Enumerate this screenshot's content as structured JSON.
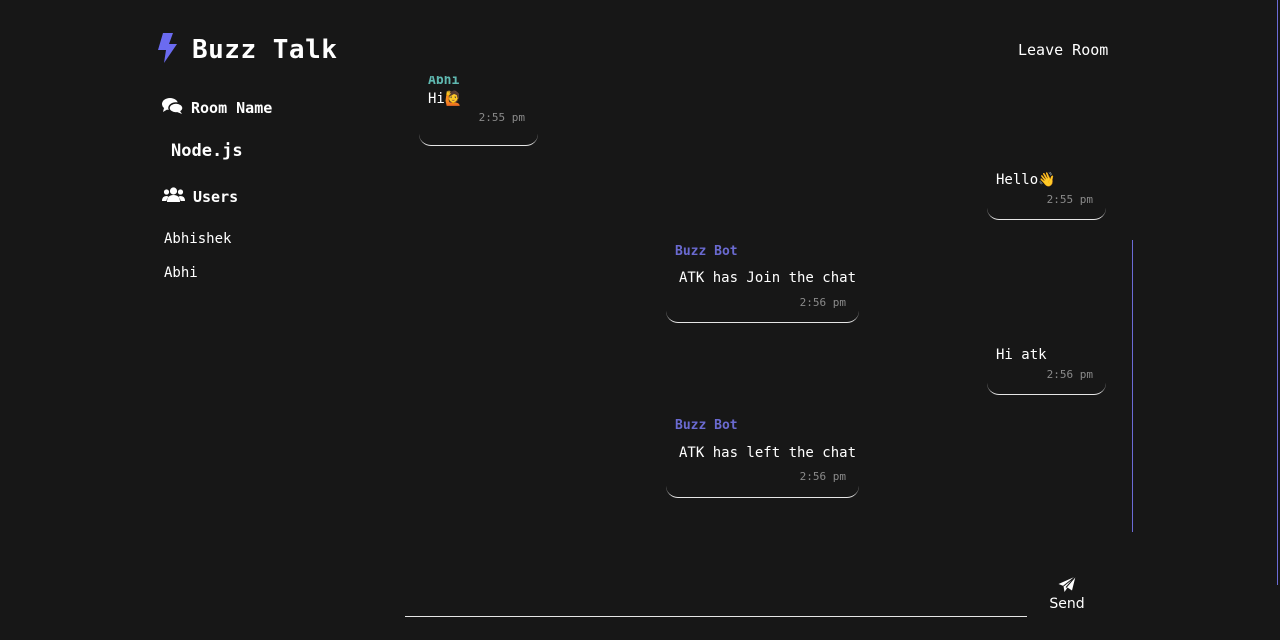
{
  "header": {
    "title": "Buzz Talk",
    "leave_label": "Leave Room",
    "logo_icon": "bolt-icon"
  },
  "sidebar": {
    "room_heading": "Room Name",
    "room_name": "Node.js",
    "users_heading": "Users",
    "users": [
      "Abhishek",
      "Abhi"
    ]
  },
  "messages": [
    {
      "sender": "Abhi",
      "text": "Hi🙋",
      "time": "2:55 pm"
    },
    {
      "sender": "",
      "text": "Hello👋",
      "time": "2:55 pm"
    },
    {
      "sender": "Buzz Bot",
      "text": "ATK has Join the chat",
      "time": "2:56 pm"
    },
    {
      "sender": "",
      "text": "Hi atk",
      "time": "2:56 pm"
    },
    {
      "sender": "Buzz Bot",
      "text": "ATK has left the chat",
      "time": "2:56 pm"
    }
  ],
  "composer": {
    "placeholder": "",
    "send_label": "Send",
    "send_icon": "paper-plane-icon"
  },
  "colors": {
    "background": "#171717",
    "accent": "#6b6bd6",
    "bot_name": "#6a6ad0",
    "user_name": "#5fb8b0",
    "timestamp": "#8a8a8a"
  }
}
